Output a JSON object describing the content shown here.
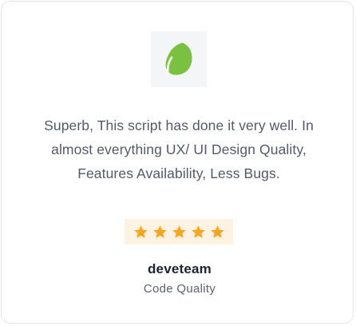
{
  "testimonial": {
    "logo": {
      "icon": "evernote-leaf-icon",
      "color": "#7ac142",
      "background": "#f4f5f7"
    },
    "quote": "Superb, This script has done it very well. In almost everything UX/ UI Design Quality, Features Availability, Less Bugs.",
    "rating": {
      "value": 5,
      "max": 5,
      "star_color": "#f7a623",
      "background": "#fef3e2"
    },
    "author": "deveteam",
    "category": "Code Quality"
  }
}
